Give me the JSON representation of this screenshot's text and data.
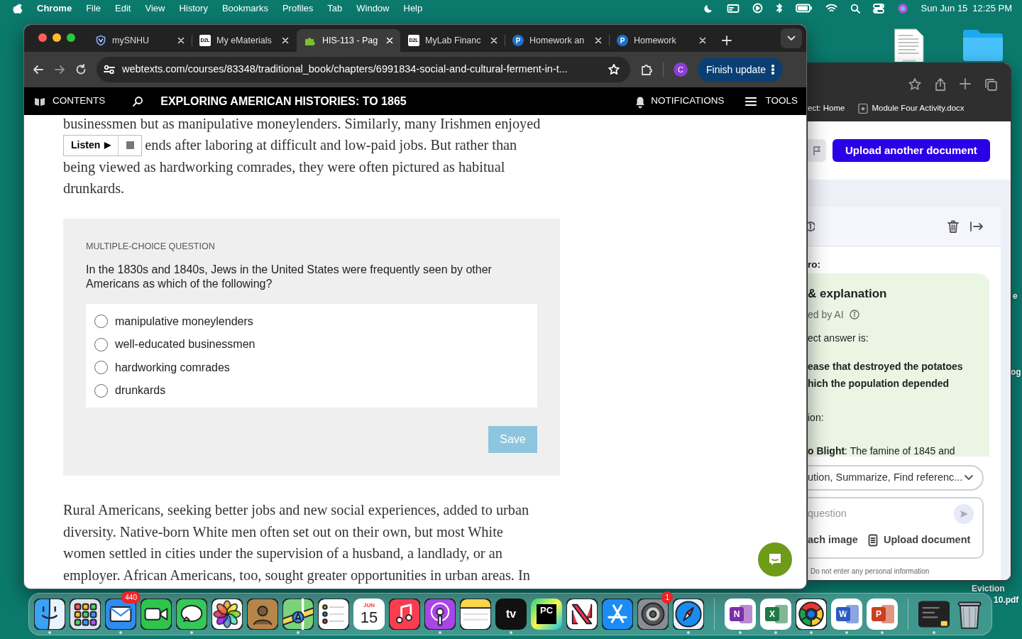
{
  "menubar": {
    "app": "Chrome",
    "menus": [
      "File",
      "Edit",
      "View",
      "History",
      "Bookmarks",
      "Profiles",
      "Tab",
      "Window",
      "Help"
    ],
    "date": "Sun Jun 15",
    "time": "12:25 PM"
  },
  "desktop_labels": [
    "e",
    "og",
    "Eviction",
    "10.pdf"
  ],
  "browser": {
    "tabs": [
      {
        "title": "mySNHU",
        "kind": "shield",
        "selected": false
      },
      {
        "title": "My eMaterials",
        "kind": "square",
        "icon_text": "D2L",
        "selected": false
      },
      {
        "title": "HIS-113 - Pag",
        "kind": "puzzle",
        "selected": true
      },
      {
        "title": "MyLab Financ",
        "kind": "square",
        "icon_text": "D2L",
        "selected": false
      },
      {
        "title": "Homework an",
        "kind": "circle",
        "icon_text": "P",
        "selected": false
      },
      {
        "title": "Homework",
        "kind": "circle",
        "icon_text": "P",
        "selected": false
      }
    ],
    "url": "webtexts.com/courses/83348/traditional_book/chapters/6991834-social-and-cultural-ferment-in-t...",
    "profile": "C",
    "update_button": "Finish update"
  },
  "reader": {
    "contents": "CONTENTS",
    "title": "EXPLORING AMERICAN HISTORIES: TO 1865",
    "notifications": "NOTIFICATIONS",
    "tools": "TOOLS",
    "paragraph_1_first_line": "businessmen but as manipulative moneylenders. Similarly, many Irishmen enjoyed",
    "paragraph_1_second_line": "ends after laboring at difficult and low-paid jobs. But rather than",
    "paragraph_1_rest": "being viewed as hardworking comrades, they were often pictured as habitual drunkards.",
    "listen": {
      "label": "Listen",
      "play": "▶"
    },
    "question": {
      "type_label": "MULTIPLE-CHOICE QUESTION",
      "prompt": "In the 1830s and 1840s, Jews in the United States were frequently seen by other Americans as which of the following?",
      "options": [
        {
          "text": "manipulative moneylenders",
          "selected": false
        },
        {
          "text": "well-educated businessmen",
          "selected": false
        },
        {
          "text": "hardworking comrades",
          "selected": false
        },
        {
          "text": "drunkards",
          "selected": false
        }
      ],
      "save": "Save",
      "save_disabled": true
    },
    "paragraph_2": "Rural Americans, seeking better jobs and new social experiences, added to urban diversity. Native-born White men often set out on their own, but most White women settled in cities under the supervision of a husband, a landlady, or an employer. African Americans, too, sought greater opportunities in urban areas. In"
  },
  "side_window": {
    "bookmarks": [
      "ect: Home",
      "Module Four Activity.docx"
    ],
    "upload_button": "Upload another document",
    "section_label": "ro:",
    "card_title": "& explanation",
    "card_subtitle": "ed by AI",
    "answer_lines": [
      {
        "text": "ect answer is:",
        "bold": false
      },
      {
        "text": "ease that destroyed the potatoes",
        "bold": true
      },
      {
        "text": "hich the population depended",
        "bold": true
      },
      {
        "text": "ion:",
        "bold": false
      },
      {
        "text": "**o Blight**: The famine of 1845 and",
        "bold": false
      }
    ],
    "mode_select": "ution, Summarize, Find referenc...",
    "input_placeholder": "question",
    "attach": "ach image",
    "upload": "Upload document",
    "disclaimer": "Do not enter any personal information"
  },
  "dock": [
    {
      "kind": "finder",
      "running": true
    },
    {
      "kind": "launchpad",
      "running": false
    },
    {
      "kind": "mail",
      "badge": "440",
      "running": true
    },
    {
      "kind": "facetime",
      "running": false
    },
    {
      "kind": "messages",
      "running": true
    },
    {
      "kind": "photos",
      "running": false
    },
    {
      "kind": "contacts",
      "running": false
    },
    {
      "kind": "maps",
      "running": true
    },
    {
      "kind": "reminders",
      "running": false
    },
    {
      "kind": "calendar",
      "month": "JUN",
      "day": "15",
      "running": false
    },
    {
      "kind": "music",
      "running": false
    },
    {
      "kind": "podcasts",
      "running": true
    },
    {
      "kind": "notes",
      "running": false
    },
    {
      "kind": "tv",
      "glyph": "tv",
      "running": true
    },
    {
      "kind": "pycharm",
      "glyph": "PC",
      "running": false
    },
    {
      "kind": "news",
      "running": false
    },
    {
      "kind": "appstore",
      "running": false
    },
    {
      "kind": "settings",
      "badge": "1",
      "running": false
    },
    {
      "kind": "safari",
      "running": true
    },
    {
      "kind": "onenote",
      "glyph": "N",
      "running": true
    },
    {
      "kind": "excel",
      "glyph": "X",
      "running": true
    },
    {
      "kind": "chrome",
      "running": true
    },
    {
      "kind": "word",
      "glyph": "W",
      "running": true
    },
    {
      "kind": "powerpoint",
      "glyph": "P",
      "running": true
    },
    {
      "kind": "terminal",
      "running": true
    },
    {
      "kind": "trash",
      "running": false
    }
  ]
}
